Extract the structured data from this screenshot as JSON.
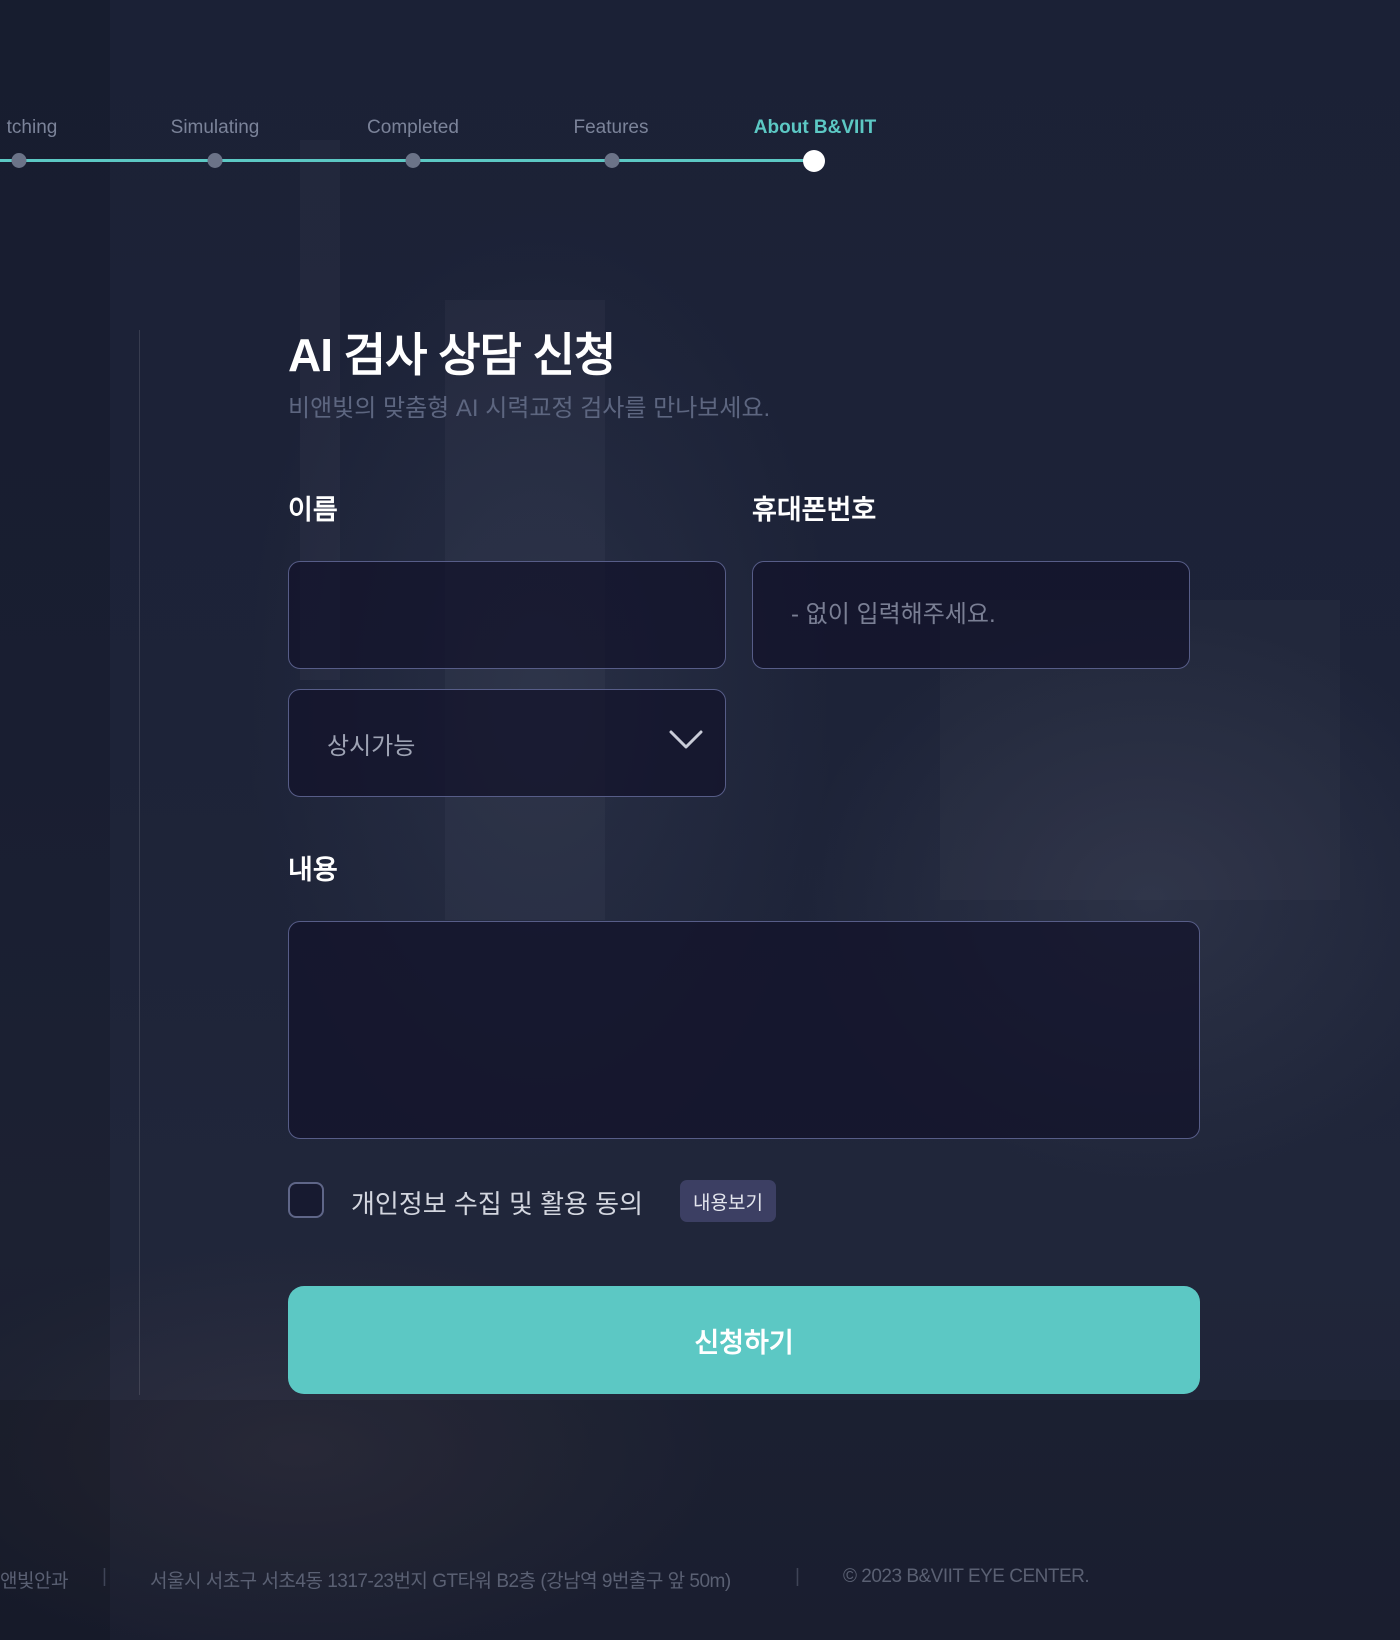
{
  "progress": {
    "steps": [
      {
        "label": "tching",
        "active": false
      },
      {
        "label": "Simulating",
        "active": false
      },
      {
        "label": "Completed",
        "active": false
      },
      {
        "label": "Features",
        "active": false
      },
      {
        "label": "About B&VIIT",
        "active": true
      }
    ],
    "accent_color": "#5cc8c4"
  },
  "form": {
    "title": "AI 검사 상담 신청",
    "subtitle": "비앤빛의 맞춤형 AI 시력교정 검사를 만나보세요.",
    "name_label": "이름",
    "name_value": "",
    "phone_label": "휴대폰번호",
    "phone_placeholder": "- 없이 입력해주세요.",
    "time_select_value": "상시가능",
    "content_label": "내용",
    "content_value": "",
    "agree_text": "개인정보 수집 및 활용 동의",
    "agree_checked": false,
    "view_button": "내용보기",
    "submit_button": "신청하기",
    "submit_color": "#5cc8c4"
  },
  "footer": {
    "name": "앤빛안과",
    "separator": "|",
    "address": "서울시 서초구 서초4동 1317-23번지 GT타워 B2층 (강남역 9번출구 앞 50m)",
    "copyright": "© 2023 B&VIIT EYE CENTER."
  }
}
